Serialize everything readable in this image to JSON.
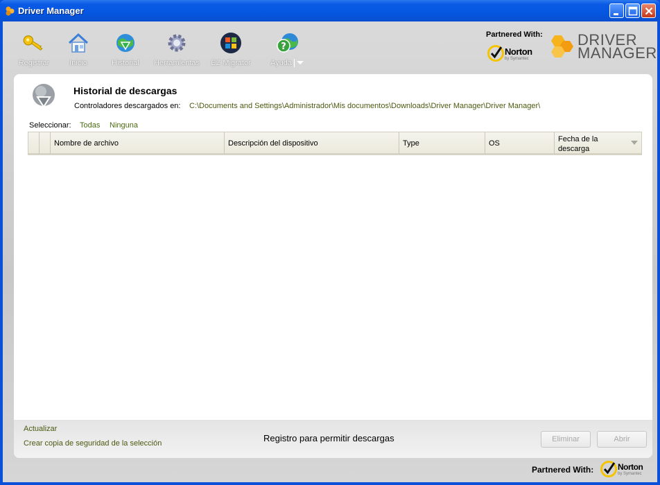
{
  "window": {
    "title": "Driver Manager",
    "controls": [
      "minimize-icon",
      "maximize-icon",
      "close-icon"
    ]
  },
  "toolbar": {
    "items": [
      {
        "label": "Registrar",
        "icon": "key-icon"
      },
      {
        "label": "Inicio",
        "icon": "home-icon"
      },
      {
        "label": "Historial",
        "icon": "history-download-icon"
      },
      {
        "label": "Herramientas",
        "icon": "gear-icon"
      },
      {
        "label": "EZ Migrator",
        "icon": "windows-logo-icon"
      },
      {
        "label": "Ayuda",
        "icon": "help-globe-icon"
      }
    ]
  },
  "branding": {
    "partnered_label": "Partnered With:",
    "norton_name": "Norton",
    "norton_sub": "by Symantec",
    "product_line1": "DRIVER",
    "product_line2": "MANAGER",
    "accent_color": "#f4a21a",
    "norton_check_color": "#f5c400"
  },
  "main": {
    "title": "Historial de descargas",
    "path_label": "Controladores descargados en:",
    "path_value": "C:\\Documents and Settings\\Administrador\\Mis documentos\\Downloads\\Driver Manager\\Driver Manager\\",
    "select_label": "Seleccionar:",
    "select_all": "Todas",
    "select_none": "Ninguna",
    "columns": [
      "Nombre de archivo",
      "Descripción del dispositivo",
      "Type",
      "OS",
      "Fecha de la descarga"
    ]
  },
  "footer": {
    "refresh_link": "Actualizar",
    "backup_link": "Crear copia de seguridad de la selección",
    "register_message": "Registro para permitir descargas",
    "delete_button": "Eliminar",
    "open_button": "Abrir"
  },
  "bottom": {
    "partnered_label": "Partnered With:",
    "norton_name": "Norton",
    "norton_sub": "by Symantec"
  }
}
